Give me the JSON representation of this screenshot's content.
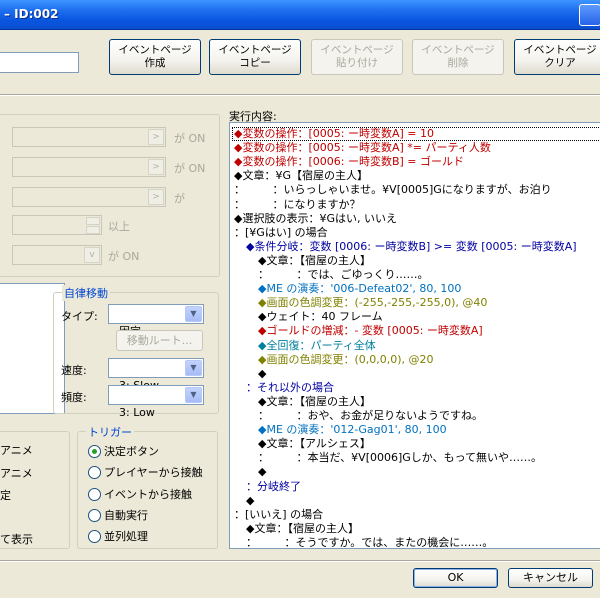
{
  "window": {
    "title": "– ID:002"
  },
  "toolbar": {
    "buttons": [
      {
        "label": "イベントページ\n作成",
        "enabled": true
      },
      {
        "label": "イベントページ\nコピー",
        "enabled": true
      },
      {
        "label": "イベントページ\n貼り付け",
        "enabled": false
      },
      {
        "label": "イベントページ\n削除",
        "enabled": false
      },
      {
        "label": "イベントページ\nクリア",
        "enabled": true
      }
    ]
  },
  "conditions": {
    "suffixes": [
      "が ON",
      "が ON",
      "が",
      "以上",
      "が ON"
    ]
  },
  "auto_move": {
    "title": "自律移動",
    "type_label": "タイプ:",
    "type_value": "固定",
    "route_button": "移動ルート...",
    "speed_label": "速度:",
    "speed_value": "3: Slow",
    "freq_label": "頻度:",
    "freq_value": "3: Low"
  },
  "options": {
    "items": [
      "アニメ",
      "アニメ",
      "定",
      "て表示"
    ]
  },
  "trigger": {
    "title": "トリガー",
    "options": [
      "決定ボタン",
      "プレイヤーから接触",
      "イベントから接触",
      "自動実行",
      "並列処理"
    ],
    "selected_index": 0
  },
  "exec": {
    "label": "実行内容:",
    "lines": [
      {
        "indent": 0,
        "text": "◆変数の操作：[0005: ー時変数A] = 10",
        "color": "#c00000"
      },
      {
        "indent": 0,
        "text": "◆変数の操作：[0005: ー時変数A] *= パーティ人数",
        "color": "#c00000"
      },
      {
        "indent": 0,
        "text": "◆変数の操作：[0006: ー時変数B] = ゴールド",
        "color": "#c00000"
      },
      {
        "indent": 0,
        "text": "◆文章：¥G【宿屋の主人】",
        "color": "#000000"
      },
      {
        "indent": 0,
        "text": "：　　　：いらっしゃいませ。¥V[0005]Gになりますが、お泊り",
        "color": "#000000"
      },
      {
        "indent": 0,
        "text": "：　　　：になりますか？",
        "color": "#000000"
      },
      {
        "indent": 0,
        "text": "◆選択肢の表示：¥Gはい, いいえ",
        "color": "#000000"
      },
      {
        "indent": 0,
        "text": "：[¥Gはい] の場合",
        "color": "#000000"
      },
      {
        "indent": 1,
        "text": "◆条件分岐：変数 [0006: ー時変数B] >= 変数 [0005: ー時変数A]",
        "color": "#0000a0"
      },
      {
        "indent": 2,
        "text": "◆文章：【宿屋の主人】",
        "color": "#000000"
      },
      {
        "indent": 2,
        "text": "：　　　：では、ごゆっくり……。",
        "color": "#000000"
      },
      {
        "indent": 2,
        "text": "◆ME の演奏：'006-Defeat02', 80, 100",
        "color": "#0070c0"
      },
      {
        "indent": 2,
        "text": "◆画面の色調変更：(-255,-255,-255,0), @40",
        "color": "#808000"
      },
      {
        "indent": 2,
        "text": "◆ウェイト：40 フレーム",
        "color": "#000000"
      },
      {
        "indent": 2,
        "text": "◆ゴールドの増減：- 変数 [0005: ー時変数A]",
        "color": "#c00000"
      },
      {
        "indent": 2,
        "text": "◆全回復：パーティ全体",
        "color": "#0080a0"
      },
      {
        "indent": 2,
        "text": "◆画面の色調変更：(0,0,0,0), @20",
        "color": "#808000"
      },
      {
        "indent": 2,
        "text": "◆",
        "color": "#000000"
      },
      {
        "indent": 1,
        "text": "：それ以外の場合",
        "color": "#0000a0"
      },
      {
        "indent": 2,
        "text": "◆文章：【宿屋の主人】",
        "color": "#000000"
      },
      {
        "indent": 2,
        "text": "：　　　：おや、お金が足りないようですね。",
        "color": "#000000"
      },
      {
        "indent": 2,
        "text": "◆ME の演奏：'012-Gag01', 80, 100",
        "color": "#0070c0"
      },
      {
        "indent": 2,
        "text": "◆文章：【アルシェス】",
        "color": "#000000"
      },
      {
        "indent": 2,
        "text": "：　　　：本当だ、¥V[0006]Gしか、もって無いや……。",
        "color": "#000000"
      },
      {
        "indent": 2,
        "text": "◆",
        "color": "#000000"
      },
      {
        "indent": 1,
        "text": "：分岐終了",
        "color": "#0000a0"
      },
      {
        "indent": 1,
        "text": "◆",
        "color": "#000000"
      },
      {
        "indent": 0,
        "text": "：[いいえ] の場合",
        "color": "#000000"
      },
      {
        "indent": 1,
        "text": "◆文章：【宿屋の主人】",
        "color": "#000000"
      },
      {
        "indent": 1,
        "text": "：　　　：そうですか。では、またの機会に……。",
        "color": "#000000"
      }
    ]
  },
  "footer": {
    "ok": "OK",
    "cancel": "キャンセル"
  }
}
